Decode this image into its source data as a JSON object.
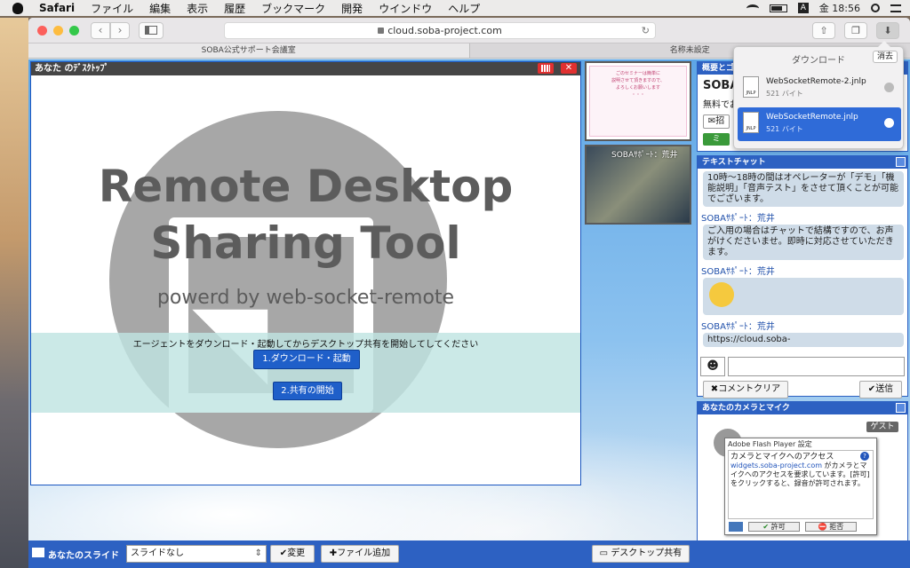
{
  "menubar": {
    "app": "Safari",
    "items": [
      "ファイル",
      "編集",
      "表示",
      "履歴",
      "ブックマーク",
      "開発",
      "ウインドウ",
      "ヘルプ"
    ],
    "input_mode": "A",
    "clock": "金 18:56"
  },
  "browser": {
    "url": "cloud.soba-project.com",
    "tabs": [
      "SOBA公式サポート会議室",
      "名称未設定"
    ]
  },
  "downloads": {
    "title": "ダウンロード",
    "clear_label": "消去",
    "items": [
      {
        "name": "WebSocketRemote-2.jnlp",
        "size": "521 バイト"
      },
      {
        "name": "WebSocketRemote.jnlp",
        "size": "521 バイト"
      }
    ]
  },
  "desktop_panel": {
    "title": "あなた のﾃﾞｽｸﾄｯﾌﾟ",
    "heading1": "Remote Desktop",
    "heading2": "Sharing Tool",
    "subheading": "powerd by web-socket-remote",
    "instruction": "エージェントをダウンロード・起動してからデスクトップ共有を開始してしてください",
    "download_btn": "1.ダウンロード・起動",
    "share_btn": "2.共有の開始"
  },
  "thumbs": {
    "video_label": "SOBAｻﾎﾟｰﾄ：荒井",
    "slide_text": [
      "ごのセミナーは簡単に",
      "説明させて頂きますので、",
      "よろしくお願いします",
      "・・・"
    ]
  },
  "overview": {
    "title": "概要とゴ",
    "heading": "SOBA",
    "text": "無料でお",
    "button": "招",
    "badge": "ミ"
  },
  "chat": {
    "title": "テキストチャット",
    "first_bubble": "10時〜18時の間はオペレーターが「デモ」「機能説明」「音声テスト」をさせて頂くことが可能でございます。",
    "messages": [
      {
        "name": "SOBAｻﾎﾟｰﾄ：荒井",
        "text": "ご入用の場合はチャットで結構ですので、お声がけくださいませ。即時に対応させていただきます。"
      },
      {
        "name": "SOBAｻﾎﾟｰﾄ：荒井",
        "text": ""
      },
      {
        "name": "SOBAｻﾎﾟｰﾄ：荒井",
        "text": "https://cloud.soba-"
      }
    ],
    "clear_btn": "コメントクリア",
    "send_btn": "送信"
  },
  "camera": {
    "title": "あなたのカメラとマイク",
    "guest_label": "ゲスト",
    "flash_title": "Adobe Flash Player 設定",
    "flash_heading": "カメラとマイクへのアクセス",
    "flash_domain": "widgets.soba-project.com",
    "flash_body": " がカメラとマイクへのアクセスを要求しています。[許可] をクリックすると、録音が許可されます。",
    "allow": "許可",
    "deny": "拒否"
  },
  "statusbar": {
    "slides_label": "あなたのスライド",
    "slide_select": "スライドなし",
    "change_btn": "変更",
    "add_file_btn": "ファイル追加",
    "share_btn": "デスクトップ共有"
  },
  "colors": {
    "accent": "#2d61c2",
    "button_blue": "#1f5fc9",
    "close_red": "#e03030"
  }
}
